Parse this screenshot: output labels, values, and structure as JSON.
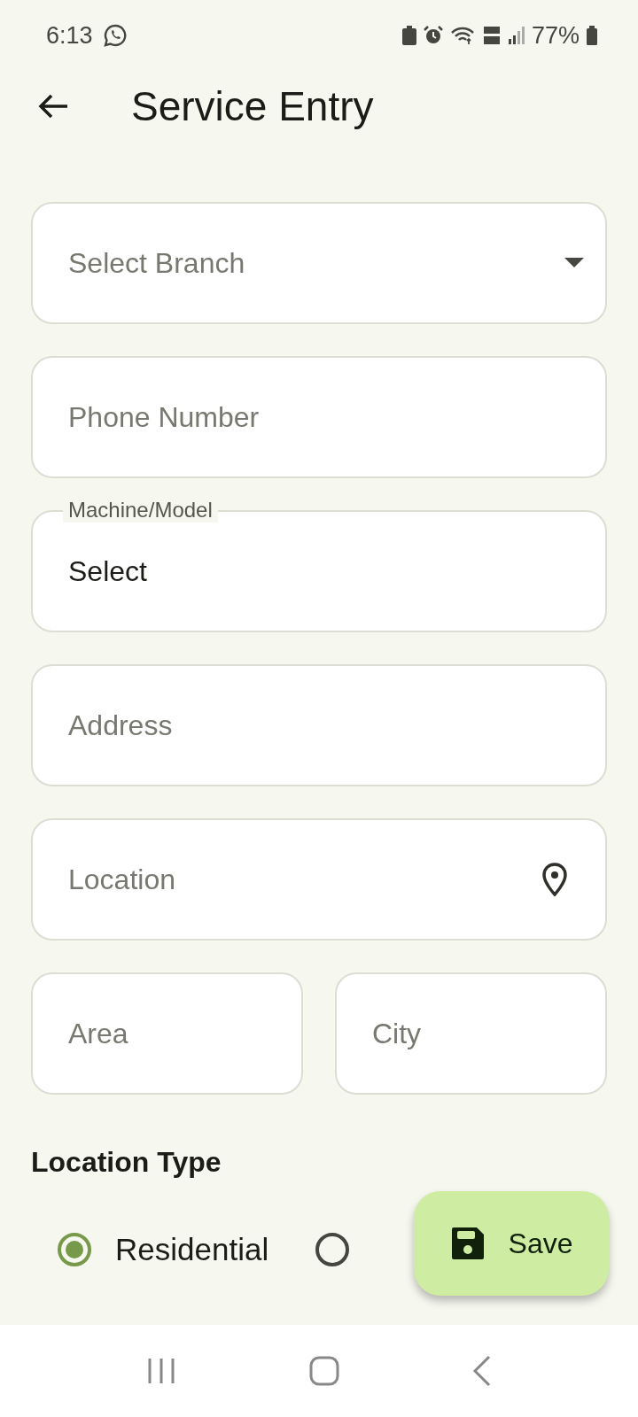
{
  "status_bar": {
    "time": "6:13",
    "battery": "77%"
  },
  "title": "Service Entry",
  "fields": [
    {
      "kind": "dropdown",
      "placeholder": "Select Branch"
    },
    {
      "kind": "text",
      "placeholder": "Phone Number"
    },
    {
      "kind": "outlined",
      "label": "Machine/Model",
      "value": "Select"
    },
    {
      "kind": "text",
      "placeholder": "Address"
    },
    {
      "kind": "location",
      "placeholder": "Location"
    }
  ],
  "row_fields": [
    {
      "placeholder": "Area"
    },
    {
      "placeholder": "City"
    }
  ],
  "location_type": {
    "heading": "Location Type",
    "options": [
      {
        "label": "Residential",
        "selected": true
      },
      {
        "selected": false
      }
    ]
  },
  "fab": {
    "label": "Save"
  }
}
